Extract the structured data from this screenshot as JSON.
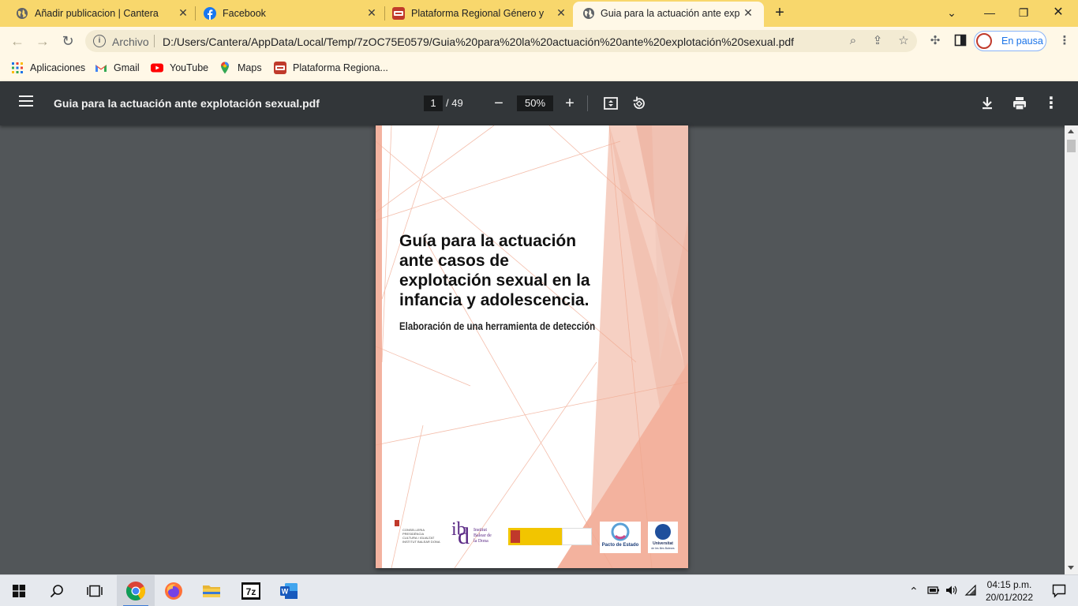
{
  "tabs": [
    {
      "label": "Añadir publicacion | Cantera",
      "icon": "globe-icon",
      "active": false
    },
    {
      "label": "Facebook",
      "icon": "facebook-icon",
      "active": false
    },
    {
      "label": "Plataforma Regional Género y M",
      "icon": "plataforma-icon",
      "active": false
    },
    {
      "label": "Guia para la actuación ante explo",
      "icon": "globe-icon",
      "active": true
    }
  ],
  "omnibox": {
    "security_label": "Archivo",
    "url": "D:/Users/Cantera/AppData/Local/Temp/7zOC75E0579/Guia%20para%20la%20actuación%20ante%20explotación%20sexual.pdf"
  },
  "profile": {
    "label": "En pausa"
  },
  "bookmarks": [
    {
      "label": "Aplicaciones",
      "icon": "apps-grid-icon"
    },
    {
      "label": "Gmail",
      "icon": "gmail-icon"
    },
    {
      "label": "YouTube",
      "icon": "youtube-icon"
    },
    {
      "label": "Maps",
      "icon": "maps-icon"
    },
    {
      "label": "Plataforma Regiona...",
      "icon": "plataforma-icon"
    }
  ],
  "pdf": {
    "title": "Guia para la actuación ante explotación sexual.pdf",
    "current_page": "1",
    "total_pages": "/ 49",
    "zoom": "50%"
  },
  "cover": {
    "title_lines": [
      "Guía para la actuación",
      "ante casos de",
      "explotación sexual en la",
      "infancia y adolescencia."
    ],
    "subtitle": "Elaboración de una herramienta de detección",
    "logos": {
      "conselleria": [
        "CONSELLERIA",
        "PRESIDÈNCIA",
        "CULTURA I IGUALTAT",
        "INSTITUT BALEAR DONA"
      ],
      "ibd": [
        "Institut",
        "Balear de",
        "la Dona"
      ],
      "pacto": "Pacto de Estado",
      "uib": [
        "Universitat",
        "de les Illes Balears"
      ]
    }
  },
  "taskbar": {
    "time": "04:15 p.m.",
    "date": "20/01/2022"
  },
  "colors": {
    "tabstrip": "#f8d76c",
    "toolbar": "#fff8e7",
    "pdf_toolbar": "#323639",
    "viewer_bg": "#525659",
    "cover_accent": "#f0a88f"
  }
}
